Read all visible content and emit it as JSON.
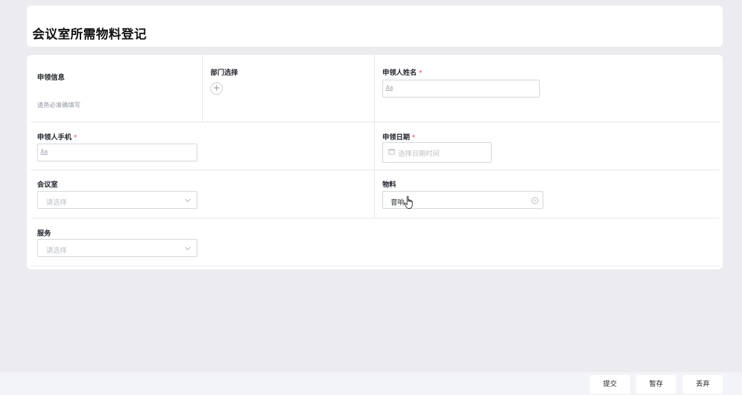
{
  "page": {
    "title": "会议室所需物料登记"
  },
  "form": {
    "section": {
      "title": "申领信息",
      "hint": "请务必准确填写"
    },
    "department": {
      "label": "部门选择",
      "add_symbol": "+"
    },
    "applicant_name": {
      "label": "申领人姓名",
      "required": "*",
      "placeholder": "Aa"
    },
    "phone": {
      "label": "申领人手机",
      "required": "*",
      "placeholder": "Aa"
    },
    "date": {
      "label": "申领日期",
      "required": "*",
      "placeholder": "选择日期时间"
    },
    "meeting_room": {
      "label": "会议室",
      "placeholder": "请选择"
    },
    "materials": {
      "label": "物料",
      "value": "音响",
      "clear_symbol": "×"
    },
    "service": {
      "label": "服务",
      "placeholder": "请选择"
    }
  },
  "footer": {
    "submit": "提交",
    "save_draft": "暂存",
    "discard": "丢弃"
  },
  "icons": [
    "plus-icon",
    "calendar-icon",
    "chevron-down-icon",
    "clear-icon",
    "hand-cursor-icon"
  ]
}
